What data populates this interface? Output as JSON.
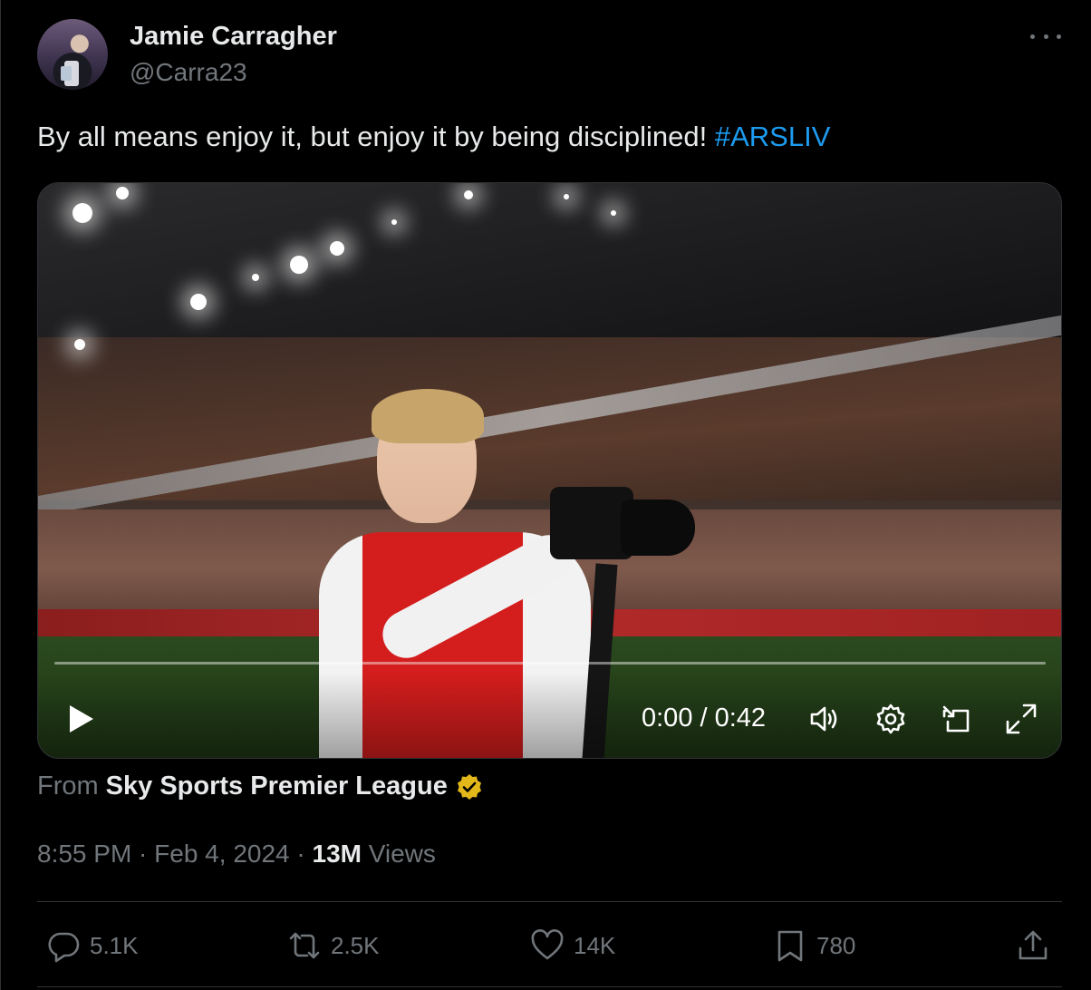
{
  "author": {
    "display_name": "Jamie Carragher",
    "handle": "@Carra23"
  },
  "tweet": {
    "text": "By all means enjoy it, but enjoy it by being disciplined! ",
    "hashtag": "#ARSLIV"
  },
  "video": {
    "time": "0:00 / 0:42"
  },
  "source": {
    "prefix": "From",
    "name": "Sky Sports Premier League"
  },
  "meta": {
    "time": "8:55 PM · Feb 4, 2024 · ",
    "views_count": "13M",
    "views_label": " Views"
  },
  "actions": {
    "replies": "5.1K",
    "reposts": "2.5K",
    "likes": "14K",
    "bookmarks": "780"
  },
  "colors": {
    "background": "#000000",
    "text": "#e7e9ea",
    "muted": "#71767b",
    "link": "#1d9bf0",
    "verified_badge": "#e2b719"
  }
}
